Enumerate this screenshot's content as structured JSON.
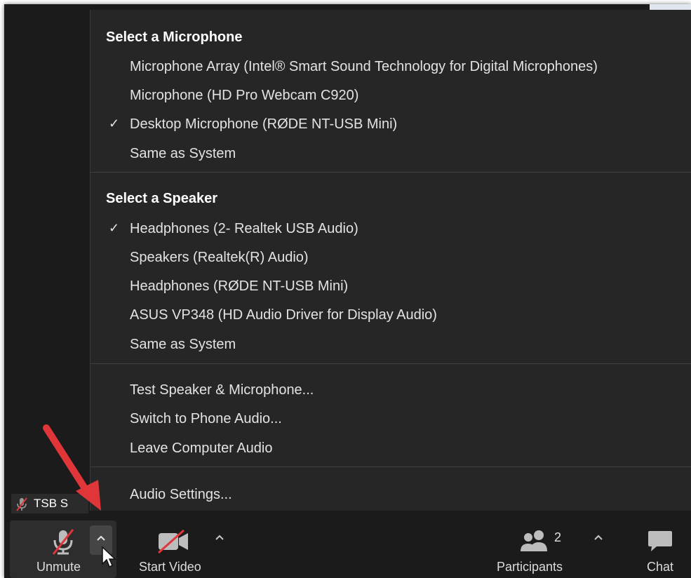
{
  "menu": {
    "microphone": {
      "heading": "Select a Microphone",
      "items": [
        {
          "label": "Microphone Array (Intel® Smart Sound Technology for Digital Microphones)"
        },
        {
          "label": "Microphone (HD Pro Webcam C920)"
        },
        {
          "label": "Desktop Microphone (RØDE NT-USB Mini)",
          "selected": true
        },
        {
          "label": "Same as System"
        }
      ]
    },
    "speaker": {
      "heading": "Select a Speaker",
      "items": [
        {
          "label": "Headphones (2- Realtek USB Audio)",
          "selected": true
        },
        {
          "label": "Speakers (Realtek(R) Audio)"
        },
        {
          "label": "Headphones (RØDE NT-USB Mini)"
        },
        {
          "label": "ASUS VP348 (HD Audio Driver for Display Audio)"
        },
        {
          "label": "Same as System"
        }
      ]
    },
    "actions": [
      {
        "label": "Test Speaker & Microphone..."
      },
      {
        "label": "Switch to Phone Audio..."
      },
      {
        "label": "Leave Computer Audio"
      }
    ],
    "settings": {
      "label": "Audio Settings..."
    },
    "check_glyph": "✓"
  },
  "name_tag": {
    "text": "TSB S"
  },
  "toolbar": {
    "unmute": {
      "label": "Unmute"
    },
    "start_video": {
      "label": "Start Video"
    },
    "participants": {
      "label": "Participants",
      "count": "2"
    },
    "chat": {
      "label": "Chat"
    }
  },
  "colors": {
    "arrow": "#e0363a",
    "muted": "#e0363a",
    "menu_bg": "#262626",
    "toolbar_bg": "#1b1b1b"
  }
}
